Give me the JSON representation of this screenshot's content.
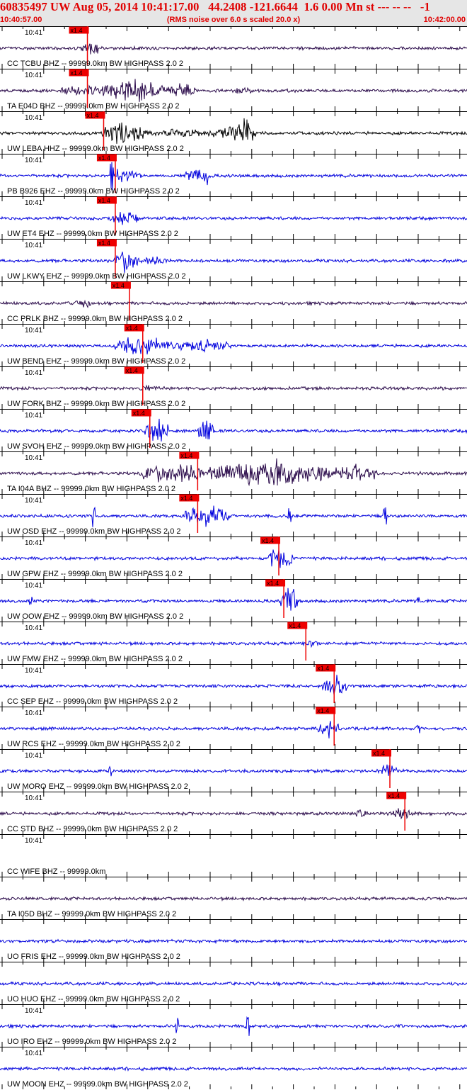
{
  "header": {
    "title": "60835497 UW Aug 05, 2014 10:41:17.00   44.2408 -121.6644  1.6 0.00 Mn st --- -- --   -1",
    "start_time": "10:40:57.00",
    "note": "(RMS noise over 6.0 s scaled 20.0 x)",
    "end_time": "10:42:00.00"
  },
  "colors": {
    "header_bg": "#e6e6e6",
    "header_text": "#e00000",
    "trace_dark": "#2a0a4a",
    "trace_blue": "#0000dd",
    "pick": "#ee0000",
    "grid": "#000000"
  },
  "panels": [
    {
      "time": "10:41",
      "label": "CC TCBU BHZ -- 99999.0km BW  HIGHPASS  2.0  2",
      "color": "dark",
      "pick": "x1.4",
      "pick_s": 20.5,
      "bursts": [
        [
          19,
          23,
          1.6
        ]
      ],
      "spikes": []
    },
    {
      "time": "10:41",
      "label": "TA E04D BHZ -- 99999.0km BW  HIGHPASS  2.0  2",
      "color": "dark",
      "pick": "x1.4",
      "pick_s": 20.5,
      "bursts": [
        [
          14,
          24,
          0.9
        ],
        [
          24,
          39,
          1.9
        ],
        [
          39,
          47,
          1.4
        ],
        [
          55,
          60,
          0.6
        ]
      ],
      "spikes": []
    },
    {
      "time": "10:41",
      "label": "UW LEBA HHZ -- 99999.0km BW  HIGHPASS  2.0  2",
      "color": "black",
      "pick": "x1.4",
      "pick_s": 24.4,
      "bursts": [
        [
          24,
          34,
          2.0
        ],
        [
          34,
          50,
          0.8
        ],
        [
          50,
          61,
          1.2
        ],
        [
          55,
          61,
          2.6
        ]
      ],
      "spikes": []
    },
    {
      "time": "10:41",
      "label": "PB B926 EHZ -- 99999.0km BW  HIGHPASS  2.0  2",
      "color": "blue",
      "pick": "x1.4",
      "pick_s": 27.2,
      "bursts": [
        [
          44,
          50,
          1.3
        ]
      ],
      "spikes": [
        [
          26.4,
          2.2
        ],
        [
          45,
          1.8
        ],
        [
          49,
          1.5
        ],
        [
          28,
          1.3
        ],
        [
          29,
          1.1
        ],
        [
          30,
          0.9
        ],
        [
          31,
          0.7
        ],
        [
          32,
          0.5
        ],
        [
          33,
          0.3
        ],
        [
          34,
          0.1
        ]
      ]
    },
    {
      "time": "10:41",
      "label": "UW ET4 EHZ -- 99999.0km BW  HIGHPASS  2.0  2",
      "color": "blue",
      "pick": "x1.4",
      "pick_s": 27.2,
      "bursts": [
        [
          26,
          33,
          1.3
        ]
      ],
      "spikes": []
    },
    {
      "time": "10:41",
      "label": "UW LKWY EHZ -- 99999.0km BW  HIGHPASS  2.0  2",
      "color": "blue",
      "pick": "x1.4",
      "pick_s": 27.2,
      "bursts": [
        [
          27,
          33,
          2.2
        ],
        [
          33,
          40,
          0.8
        ]
      ],
      "spikes": []
    },
    {
      "time": "",
      "label": "CC PRLK BHZ -- 99999.0km BW  HIGHPASS  2.0  2",
      "color": "dark",
      "pick": "x1.4",
      "pick_s": 30.6,
      "bursts": [
        [
          17,
          22,
          0.8
        ]
      ],
      "spikes": []
    },
    {
      "time": "10:41",
      "label": "UW BEND EHZ -- 99999.0km BW  HIGHPASS  2.0  2",
      "color": "blue",
      "pick": "x1.4",
      "pick_s": 33.8,
      "bursts": [
        [
          27,
          40,
          1.9
        ],
        [
          40,
          55,
          1.0
        ],
        [
          47,
          53,
          1.6
        ]
      ],
      "spikes": []
    },
    {
      "time": "10:41",
      "label": "UW FORK BHZ -- 99999.0km BW  HIGHPASS  2.0  2",
      "color": "dark",
      "pick": "x1.4",
      "pick_s": 33.8,
      "bursts": [
        [
          33,
          38,
          0.6
        ]
      ],
      "spikes": []
    },
    {
      "time": "10:41",
      "label": "UW SVOH EHZ -- 99999.0km BW  HIGHPASS  2.0  2",
      "color": "blue",
      "pick": "x1.4",
      "pick_s": 35.5,
      "bursts": [
        [
          34,
          40,
          2.4
        ],
        [
          47,
          51,
          2.4
        ]
      ],
      "spikes": []
    },
    {
      "time": "10:41",
      "label": "TA I04A BHZ -- 99999.0km BW  HIGHPASS  2.0  2",
      "color": "dark",
      "pick": "x1.4",
      "pick_s": 47.0,
      "bursts": [
        [
          33,
          50,
          1.9
        ],
        [
          50,
          78,
          2.4
        ],
        [
          78,
          90,
          1.6
        ]
      ],
      "spikes": []
    },
    {
      "time": "10:41",
      "label": "UW OSD EHZ -- 99999.0km BW  HIGHPASS  2.0  2",
      "color": "blue",
      "pick": "x1.4",
      "pick_s": 47.0,
      "bursts": [
        [
          44,
          55,
          1.8
        ]
      ],
      "spikes": [
        [
          22,
          1.6
        ],
        [
          69,
          1.6
        ],
        [
          92,
          1.6
        ]
      ]
    },
    {
      "time": "10:41",
      "label": "UW GPW EHZ -- 99999.0km BW  HIGHPASS  2.0  2",
      "color": "blue",
      "pick": "x1.4",
      "pick_s": 66.5,
      "bursts": [
        [
          64,
          70,
          2.4
        ]
      ],
      "spikes": []
    },
    {
      "time": "10:41",
      "label": "UW OOW EHZ -- 99999.0km BW  HIGHPASS  2.0  2",
      "color": "blue",
      "pick": "x1.4",
      "pick_s": 67.7,
      "bursts": [
        [
          67,
          71,
          2.4
        ]
      ],
      "spikes": [
        [
          7,
          0.8
        ],
        [
          100,
          0.8
        ]
      ]
    },
    {
      "time": "10:41",
      "label": "UW FMW EHZ -- 99999.0km BW  HIGHPASS  2.0  2",
      "color": "blue",
      "pick": "x1.4",
      "pick_s": 73.0,
      "bursts": [
        [
          72,
          76,
          0.6
        ]
      ],
      "spikes": []
    },
    {
      "time": "10:41",
      "label": "CC SEP EHZ -- 99999.0km BW  HIGHPASS  2.0  2",
      "color": "blue",
      "pick": "x1.4",
      "pick_s": 79.8,
      "bursts": [
        [
          77,
          83,
          1.8
        ]
      ],
      "spikes": []
    },
    {
      "time": "10:41",
      "label": "UW RCS EHZ -- 99999.0km BW  HIGHPASS  2.0  2",
      "color": "blue",
      "pick": "x1.4",
      "pick_s": 79.8,
      "bursts": [
        [
          76,
          81,
          1.8
        ]
      ],
      "spikes": [
        [
          100,
          1.0
        ]
      ]
    },
    {
      "time": "10:41",
      "label": "UW MORO EHZ -- 99999.0km BW  HIGHPASS  2.0  2",
      "color": "blue",
      "pick": "x1.4",
      "pick_s": 93.2,
      "bursts": [
        [
          91,
          95,
          1.8
        ]
      ],
      "spikes": [
        [
          26,
          1.0
        ]
      ]
    },
    {
      "time": "10:41",
      "label": "CC STD BHZ -- 99999.0km BW  HIGHPASS  2.0  2",
      "color": "dark",
      "pick": "x1.4",
      "pick_s": 96.8,
      "bursts": [
        [
          94,
          98,
          1.3
        ],
        [
          85,
          88,
          0.8
        ]
      ],
      "spikes": []
    },
    {
      "time": "10:41",
      "label": "CC WIFE BHZ -- 99999.0km",
      "color": "none",
      "pick": "",
      "pick_s": 0,
      "bursts": [],
      "spikes": []
    },
    {
      "time": "",
      "label": "TA I05D BHZ -- 99999.0km BW  HIGHPASS  2.0  2",
      "color": "dark",
      "pick": "",
      "pick_s": 0,
      "bursts": [],
      "spikes": []
    },
    {
      "time": "",
      "label": "UO FRIS EHZ -- 99999.0km BW  HIGHPASS  2.0  2",
      "color": "blue",
      "pick": "",
      "pick_s": 0,
      "bursts": [],
      "spikes": []
    },
    {
      "time": "",
      "label": "UO HUO EHZ -- 99999.0km BW  HIGHPASS  2.0  2",
      "color": "blue",
      "pick": "",
      "pick_s": 0,
      "bursts": [],
      "spikes": []
    },
    {
      "time": "10:41",
      "label": "UO IRO EHZ -- 99999.0km BW  HIGHPASS  2.0  2",
      "color": "blue",
      "pick": "",
      "pick_s": 0,
      "bursts": [],
      "spikes": [
        [
          42,
          1.6
        ],
        [
          59,
          1.8
        ]
      ]
    },
    {
      "time": "10:41",
      "label": "UW MOON EHZ -- 99999.0km BW  HIGHPASS  2.0  2",
      "color": "blue",
      "pick": "",
      "pick_s": 0,
      "bursts": [],
      "spikes": []
    }
  ]
}
